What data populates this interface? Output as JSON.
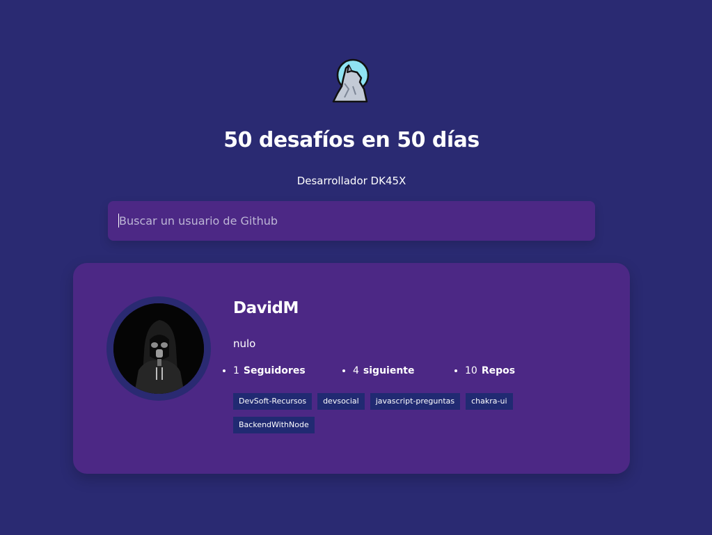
{
  "header": {
    "logo_icon": "howling-wolf-icon",
    "title": "50 desafíos en 50 días",
    "subtitle": "Desarrollador DK45X"
  },
  "search": {
    "placeholder": "Buscar un usuario de Github",
    "value": ""
  },
  "profile": {
    "avatar_icon": "gas-mask-hoodie-avatar",
    "name": "DavidM",
    "bio": "nulo",
    "stats": {
      "followers_count": "1",
      "followers_label": "Seguidores",
      "following_count": "4",
      "following_label": "siguiente",
      "repos_count": "10",
      "repos_label": "Repos"
    },
    "repos": [
      "DevSoft-Recursos",
      "devsocial",
      "javascript-preguntas",
      "chakra-ui",
      "BackendWithNode"
    ]
  },
  "colors": {
    "background": "#2a2a72",
    "card": "#4c2885",
    "repo_tag": "#212a72",
    "text": "#ffffff"
  }
}
